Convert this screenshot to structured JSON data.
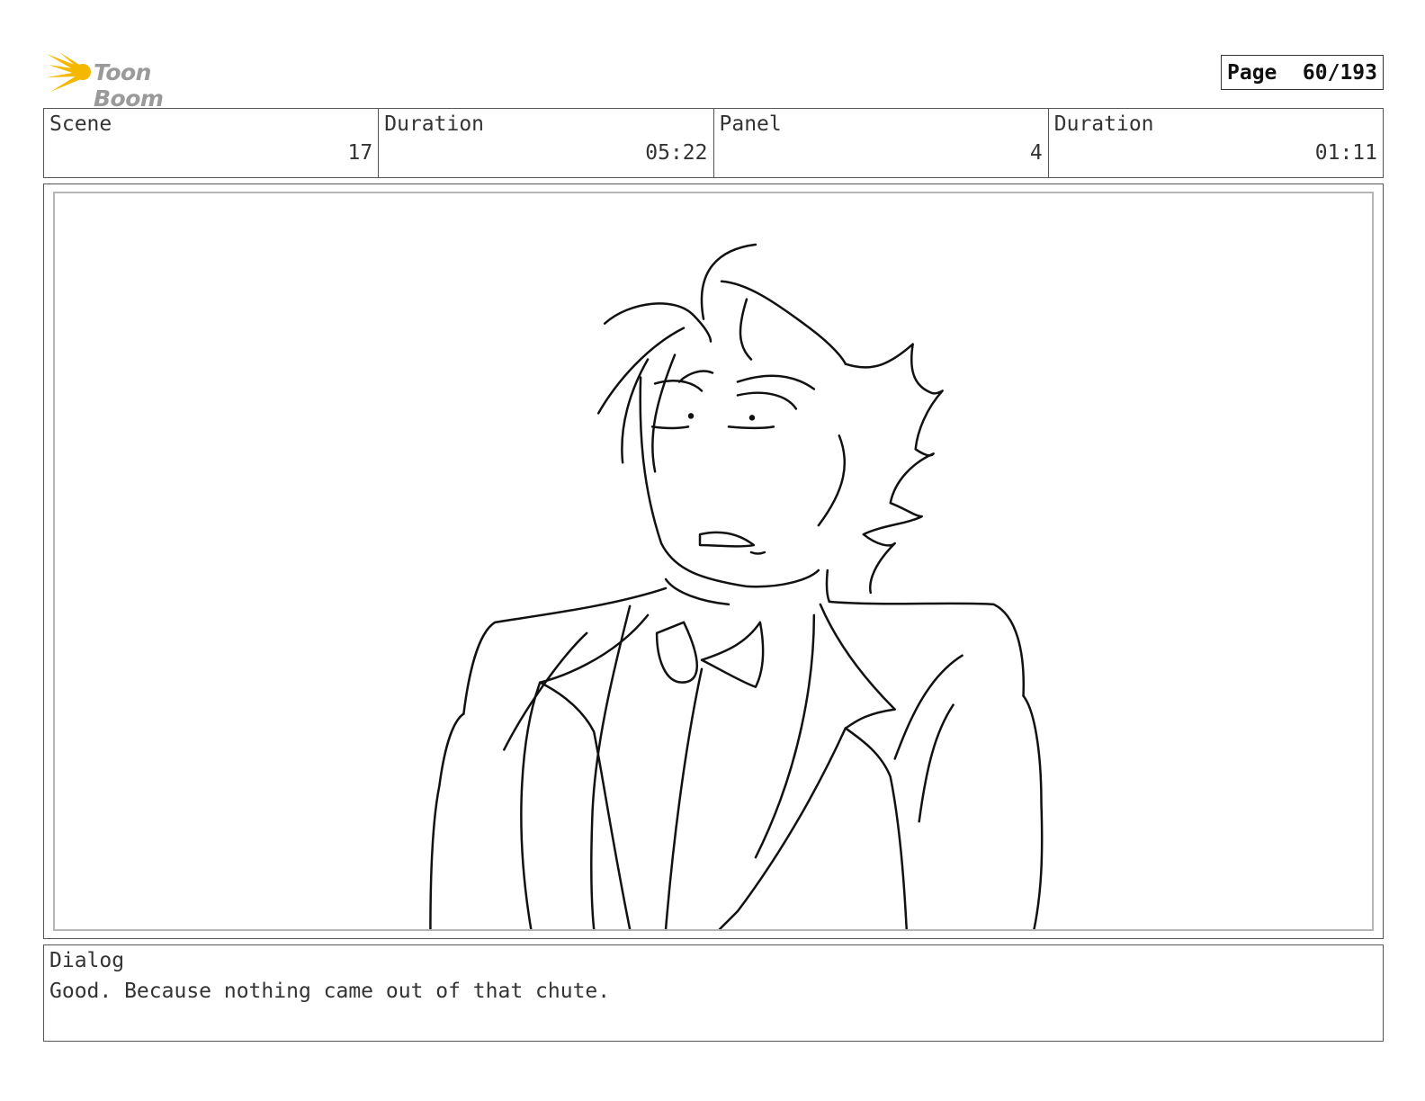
{
  "logo": {
    "text": "Toon Boom",
    "icon": "star-burst-icon",
    "accent_color": "#f5b800"
  },
  "page": {
    "label": "Page",
    "value": "60/193"
  },
  "info": {
    "scene_label": "Scene",
    "scene_value": "17",
    "scene_duration_label": "Duration",
    "scene_duration_value": "05:22",
    "panel_label": "Panel",
    "panel_value": "4",
    "panel_duration_label": "Duration",
    "panel_duration_value": "01:11"
  },
  "panel_image": {
    "subject": "sketch-character-in-tuxedo"
  },
  "dialog": {
    "label": "Dialog",
    "text": "Good. Because nothing came out of that chute."
  }
}
